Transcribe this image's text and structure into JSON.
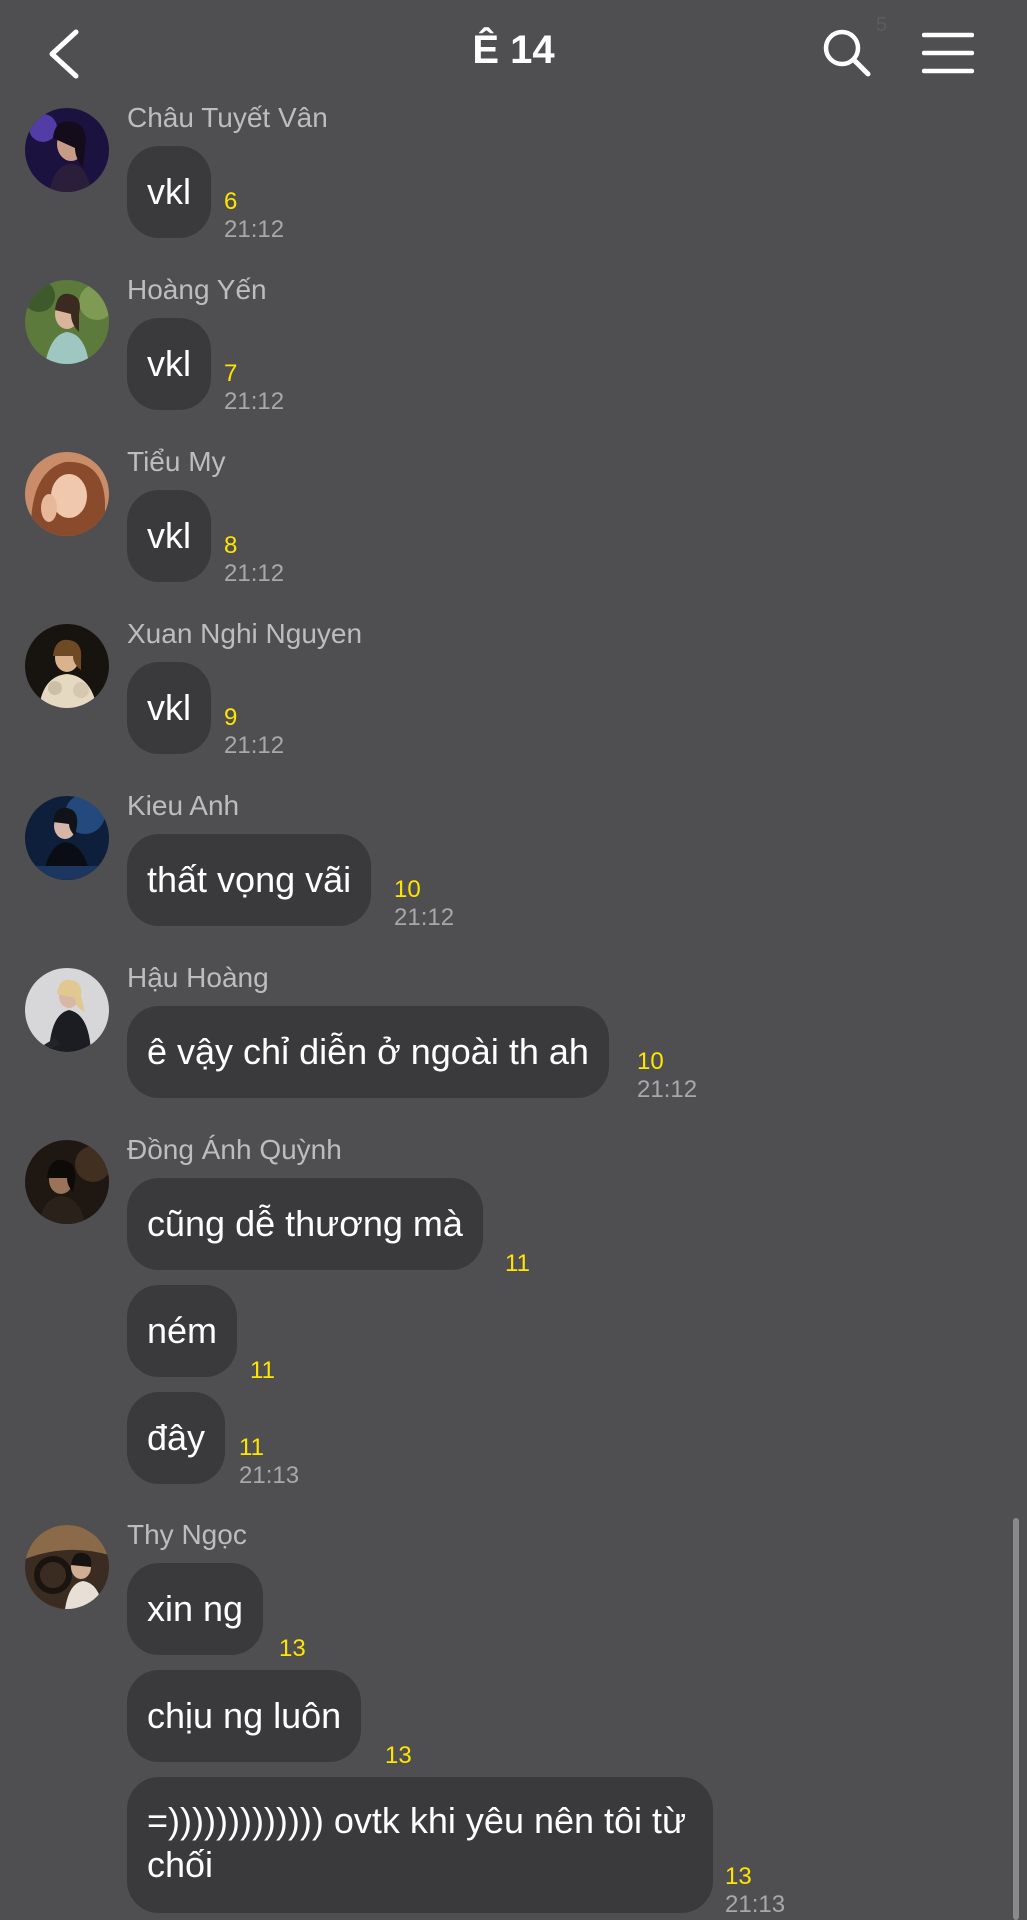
{
  "header": {
    "title": "Ê 14",
    "ghost_text": "5"
  },
  "messages": [
    {
      "sender": "Châu Tuyết Vân",
      "avatar": "photo-dark-purple",
      "bubbles": [
        {
          "text": "vkl",
          "count": "6",
          "time": "21:12"
        }
      ]
    },
    {
      "sender": "Hoàng Yến",
      "avatar": "photo-green-nature",
      "bubbles": [
        {
          "text": "vkl",
          "count": "7",
          "time": "21:12"
        }
      ]
    },
    {
      "sender": "Tiểu My",
      "avatar": "photo-warm-portrait",
      "bubbles": [
        {
          "text": "vkl",
          "count": "8",
          "time": "21:12"
        }
      ]
    },
    {
      "sender": "Xuan Nghi Nguyen",
      "avatar": "photo-dark-fur",
      "bubbles": [
        {
          "text": "vkl",
          "count": "9",
          "time": "21:12"
        }
      ]
    },
    {
      "sender": "Kieu Anh",
      "avatar": "photo-blue-night",
      "bubbles": [
        {
          "text": "thất vọng vãi",
          "count": "10",
          "time": "21:12"
        }
      ]
    },
    {
      "sender": "Hậu Hoàng",
      "avatar": "photo-light-grey",
      "bubbles": [
        {
          "text": "ê vậy chỉ diễn ở ngoài th ah",
          "count": "10",
          "time": "21:12"
        }
      ]
    },
    {
      "sender": "Đồng Ánh Quỳnh",
      "avatar": "photo-dark-brown",
      "bubbles": [
        {
          "text": "cũng dễ thương mà",
          "count": "11",
          "time": ""
        },
        {
          "text": "ném",
          "count": "11",
          "time": ""
        },
        {
          "text": "đây",
          "count": "11",
          "time": "21:13"
        }
      ]
    },
    {
      "sender": "Thy Ngọc",
      "avatar": "photo-car-interior",
      "bubbles": [
        {
          "text": "xin ng",
          "count": "13",
          "time": ""
        },
        {
          "text": "chịu ng luôn",
          "count": "13",
          "time": ""
        },
        {
          "text": "=))))))))))))) ovtk khi yêu nên tôi từ chối",
          "count": "13",
          "time": "21:13"
        }
      ]
    }
  ],
  "colors": {
    "background": "#4f4f51",
    "bubble": "#3a3a3c",
    "read_count": "#ffe500",
    "timestamp": "#a8a8a8",
    "sender_name": "#bdbdbd"
  }
}
